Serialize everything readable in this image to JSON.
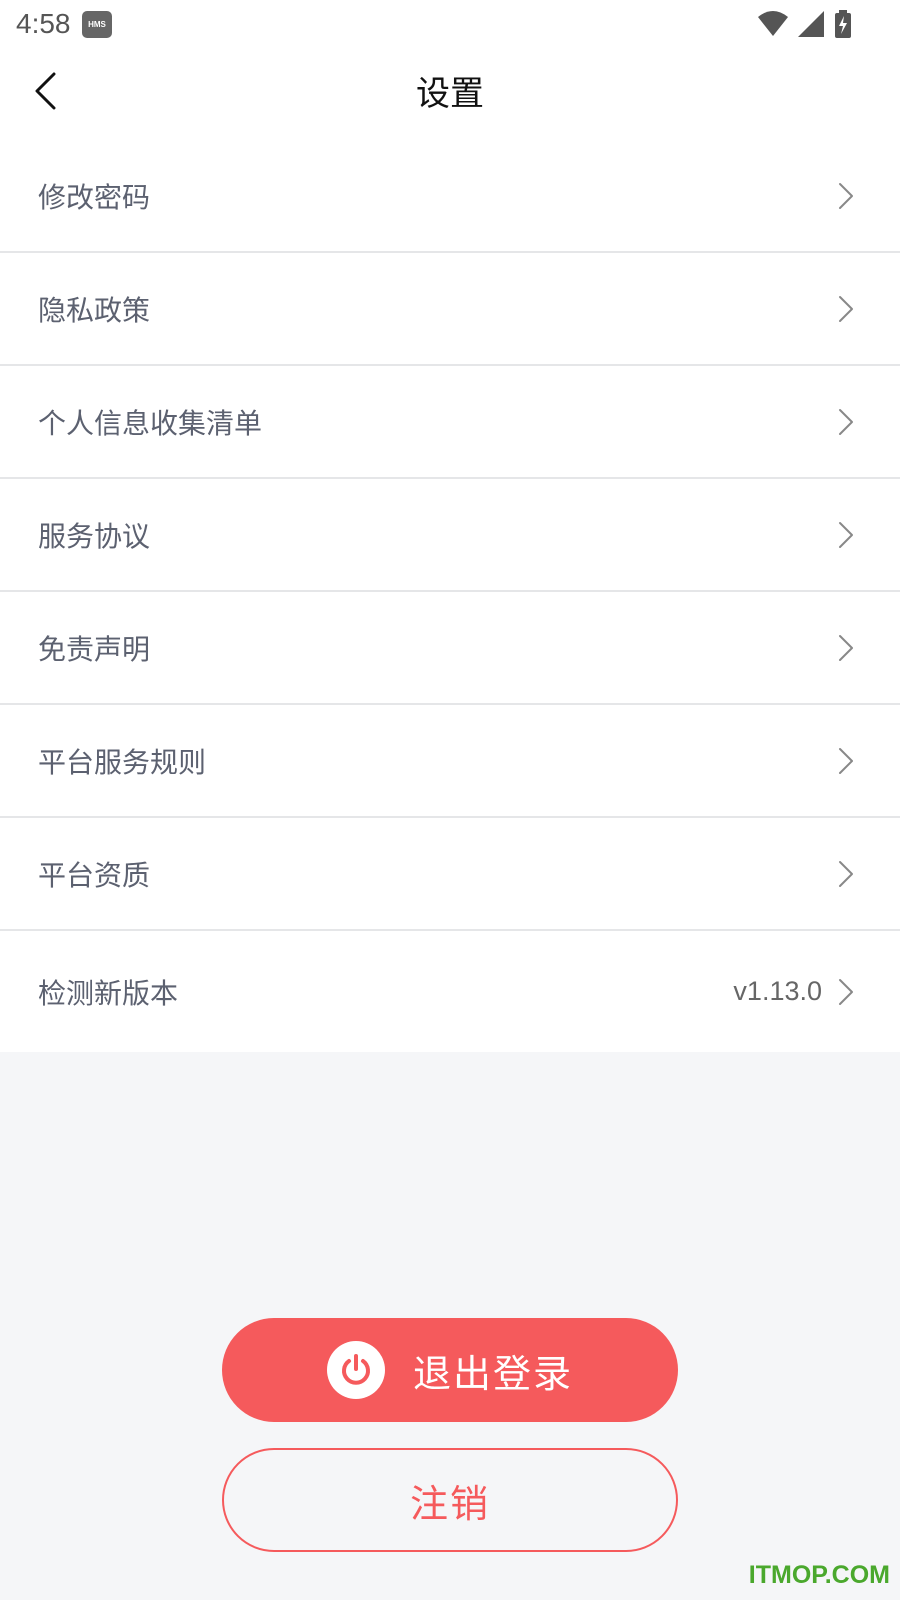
{
  "status_bar": {
    "time": "4:58",
    "badge": "HMS",
    "icons": [
      "wifi-icon",
      "signal-icon",
      "battery-charging-icon"
    ]
  },
  "header": {
    "title": "设置",
    "back_icon": "chevron-left-icon"
  },
  "menu": {
    "items": [
      {
        "label": "修改密码",
        "icon": "chevron-right-icon"
      },
      {
        "label": "隐私政策",
        "icon": "chevron-right-icon"
      },
      {
        "label": "个人信息收集清单",
        "icon": "chevron-right-icon"
      },
      {
        "label": "服务协议",
        "icon": "chevron-right-icon"
      },
      {
        "label": "免责声明",
        "icon": "chevron-right-icon"
      },
      {
        "label": "平台服务规则",
        "icon": "chevron-right-icon"
      },
      {
        "label": "平台资质",
        "icon": "chevron-right-icon"
      },
      {
        "label": "检测新版本",
        "value": "v1.13.0",
        "icon": "chevron-right-icon"
      }
    ]
  },
  "actions": {
    "logout_label": "退出登录",
    "logout_icon": "power-icon",
    "cancel_label": "注销"
  },
  "watermark": "ITMOP.COM",
  "colors": {
    "accent": "#f55a5c",
    "background": "#f5f6f8",
    "item_text": "#5c6170",
    "watermark": "#4aa82d"
  }
}
